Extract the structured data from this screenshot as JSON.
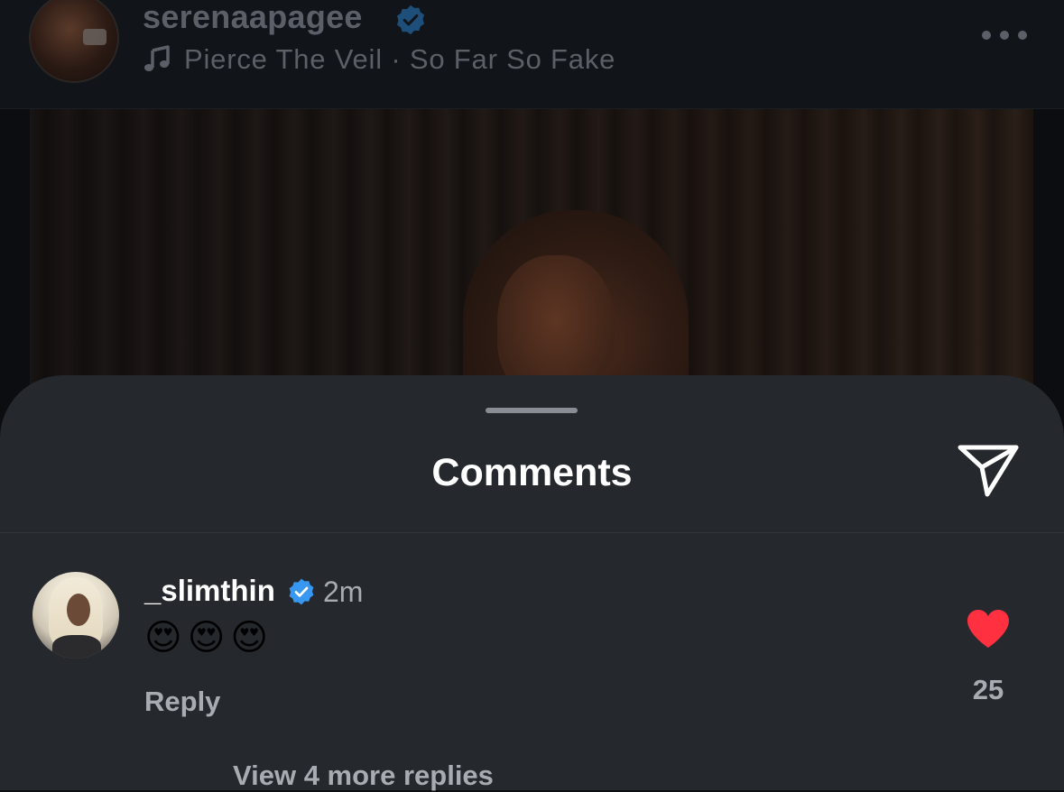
{
  "post": {
    "username": "serenaapagee",
    "audio": "Pierce The Veil · So Far So Fake"
  },
  "comments_sheet": {
    "title": "Comments",
    "comment": {
      "username": "_slimthin",
      "time": "2m",
      "text": "😍😍😍",
      "reply_label": "Reply",
      "likes": "25",
      "view_replies": "View 4 more replies"
    }
  },
  "colors": {
    "verified": "#3897f0",
    "like_heart": "#ff3040",
    "sheet_background": "#25282c"
  },
  "icons": [
    "verified-badge-icon",
    "music-note-icon",
    "more-options-icon",
    "share-send-icon",
    "heart-filled-icon"
  ]
}
